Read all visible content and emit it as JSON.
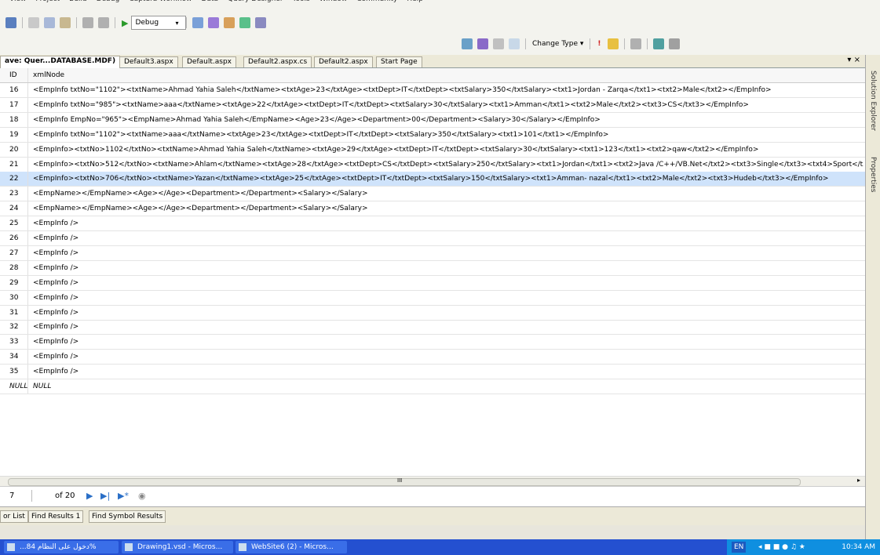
{
  "menu": [
    "View",
    "Project",
    "Build",
    "Debug",
    "Captura Workflow",
    "Data",
    "Query Designer",
    "Tools",
    "Window",
    "Community",
    "Help"
  ],
  "toolbar": {
    "config": "Debug",
    "change_type": "Change Type"
  },
  "tabs": [
    {
      "label": "ave: Quer...DATABASE.MDF)",
      "active": true
    },
    {
      "label": "Default3.aspx"
    },
    {
      "label": "Default.aspx"
    },
    {
      "label": "Default2.aspx.cs"
    },
    {
      "label": "Default2.aspx"
    },
    {
      "label": "Start Page"
    }
  ],
  "tab_controls": "▾ ×",
  "grid": {
    "columns": [
      "ID",
      "xmlNode"
    ],
    "rows": [
      {
        "id": "16",
        "xml": "<EmpInfo txtNo=\"1102\"><txtName>Ahmad Yahia Saleh</txtName><txtAge>23</txtAge><txtDept>IT</txtDept><txtSalary>350</txtSalary><txt1>Jordan - Zarqa</txt1><txt2>Male</txt2></EmpInfo>"
      },
      {
        "id": "17",
        "xml": "<EmpInfo txtNo=\"985\"><txtName>aaa</txtName><txtAge>22</txtAge><txtDept>IT</txtDept><txtSalary>30</txtSalary><txt1>Amman</txt1><txt2>Male</txt2><txt3>CS</txt3></EmpInfo>"
      },
      {
        "id": "18",
        "xml": "<EmpInfo EmpNo=\"965\"><EmpName>Ahmad Yahia Saleh</EmpName><Age>23</Age><Department>00</Department><Salary>30</Salary></EmpInfo>"
      },
      {
        "id": "19",
        "xml": "<EmpInfo txtNo=\"1102\"><txtName>aaa</txtName><txtAge>23</txtAge><txtDept>IT</txtDept><txtSalary>350</txtSalary><txt1>101</txt1></EmpInfo>"
      },
      {
        "id": "20",
        "xml": "<EmpInfo><txtNo>1102</txtNo><txtName>Ahmad Yahia Saleh</txtName><txtAge>29</txtAge><txtDept>IT</txtDept><txtSalary>30</txtSalary><txt1>123</txt1><txt2>qaw</txt2></EmpInfo>"
      },
      {
        "id": "21",
        "xml": "<EmpInfo><txtNo>512</txtNo><txtName>Ahlam</txtName><txtAge>28</txtAge><txtDept>CS</txtDept><txtSalary>250</txtSalary><txt1>Jordan</txt1><txt2>Java /C++/VB.Net</txt2><txt3>Single</txt3><txt4>Sport</txt"
      },
      {
        "id": "22",
        "xml": "<EmpInfo><txtNo>706</txtNo><txtName>Yazan</txtName><txtAge>25</txtAge><txtDept>IT</txtDept><txtSalary>150</txtSalary><txt1>Amman- nazal</txt1><txt2>Male</txt2><txt3>Hudeb</txt3></EmpInfo>",
        "selected": true
      },
      {
        "id": "23",
        "xml": "<EmpName></EmpName><Age></Age><Department></Department><Salary></Salary>"
      },
      {
        "id": "24",
        "xml": "<EmpName></EmpName><Age></Age><Department></Department><Salary></Salary>"
      },
      {
        "id": "25",
        "xml": "<EmpInfo />"
      },
      {
        "id": "26",
        "xml": "<EmpInfo />"
      },
      {
        "id": "27",
        "xml": "<EmpInfo />"
      },
      {
        "id": "28",
        "xml": "<EmpInfo />"
      },
      {
        "id": "29",
        "xml": "<EmpInfo />"
      },
      {
        "id": "30",
        "xml": "<EmpInfo />"
      },
      {
        "id": "31",
        "xml": "<EmpInfo />"
      },
      {
        "id": "32",
        "xml": "<EmpInfo />"
      },
      {
        "id": "33",
        "xml": "<EmpInfo />"
      },
      {
        "id": "34",
        "xml": "<EmpInfo />"
      },
      {
        "id": "35",
        "xml": "<EmpInfo />"
      },
      {
        "id": "NULL",
        "xml": "NULL",
        "null": true
      }
    ]
  },
  "hscroll_label": "III",
  "navigator": {
    "current": "7",
    "of_total": "of 20"
  },
  "bottom_tabs": [
    "or List",
    "Find Results 1",
    "Find Symbol Results"
  ],
  "side_panels": [
    "Solution Explorer",
    "Properties"
  ],
  "taskbar": {
    "tasks": [
      "...دخول على النظام 84%",
      "Drawing1.vsd - Micros...",
      "WebSite6 (2) - Micros..."
    ],
    "lang": "EN",
    "clock": "10:34 AM"
  }
}
